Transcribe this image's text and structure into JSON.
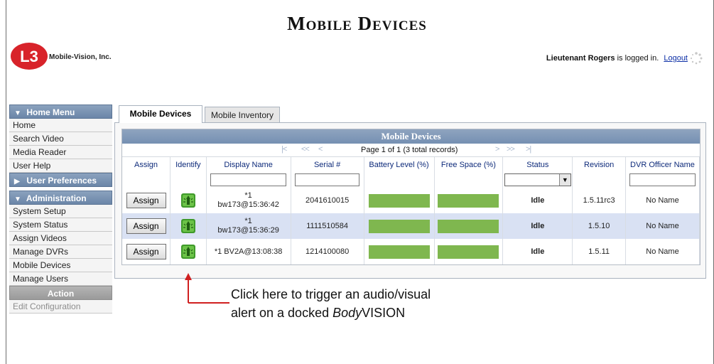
{
  "page": {
    "title": "Mobile Devices",
    "company": "Mobile-Vision, Inc."
  },
  "login": {
    "user": "Lieutenant Rogers",
    "suffix": "is logged in.",
    "logout": "Logout"
  },
  "sidebar": {
    "home_menu": {
      "label": "Home Menu",
      "items": [
        "Home",
        "Search Video",
        "Media Reader",
        "User Help"
      ]
    },
    "user_prefs": {
      "label": "User Preferences"
    },
    "administration": {
      "label": "Administration",
      "items": [
        "System Setup",
        "System Status",
        "Assign Videos",
        "Manage DVRs",
        "Mobile Devices",
        "Manage Users"
      ]
    },
    "action": {
      "label": "Action",
      "items": [
        "Edit Configuration"
      ]
    }
  },
  "tabs": [
    {
      "label": "Mobile Devices"
    },
    {
      "label": "Mobile Inventory"
    }
  ],
  "table": {
    "title": "Mobile Devices",
    "pager": {
      "text": "Page 1 of 1 (3 total records)"
    },
    "columns": [
      "Assign",
      "Identify",
      "Display Name",
      "Serial #",
      "Battery Level (%)",
      "Free Space (%)",
      "Status",
      "Revision",
      "DVR Officer Name"
    ],
    "rows": [
      {
        "assign": "Assign",
        "name_l1": "*1",
        "name_l2": "bw173@15:36:42",
        "serial": "2041610015",
        "battery": 1.0,
        "free": 1.0,
        "status": "Idle",
        "revision": "1.5.11rc3",
        "officer": "No Name"
      },
      {
        "assign": "Assign",
        "name_l1": "*1",
        "name_l2": "bw173@15:36:29",
        "serial": "1111510584",
        "battery": 1.0,
        "free": 1.0,
        "status": "Idle",
        "revision": "1.5.10",
        "officer": "No Name"
      },
      {
        "assign": "Assign",
        "name_l1": "*1 BV2A@13:08:38",
        "name_l2": "",
        "serial": "1214100080",
        "battery": 1.0,
        "free": 1.0,
        "status": "Idle",
        "revision": "1.5.11",
        "officer": "No Name"
      }
    ]
  },
  "callout": {
    "line1": "Click here to trigger an audio/visual",
    "line2_prefix": "alert on a docked ",
    "line2_italic": "Body",
    "line2_suffix": "VISION"
  },
  "colors": {
    "accent": "#7590b2",
    "bar": "#7fb74f",
    "callout": "#d02020",
    "row_alt": "#d9e1f3"
  }
}
